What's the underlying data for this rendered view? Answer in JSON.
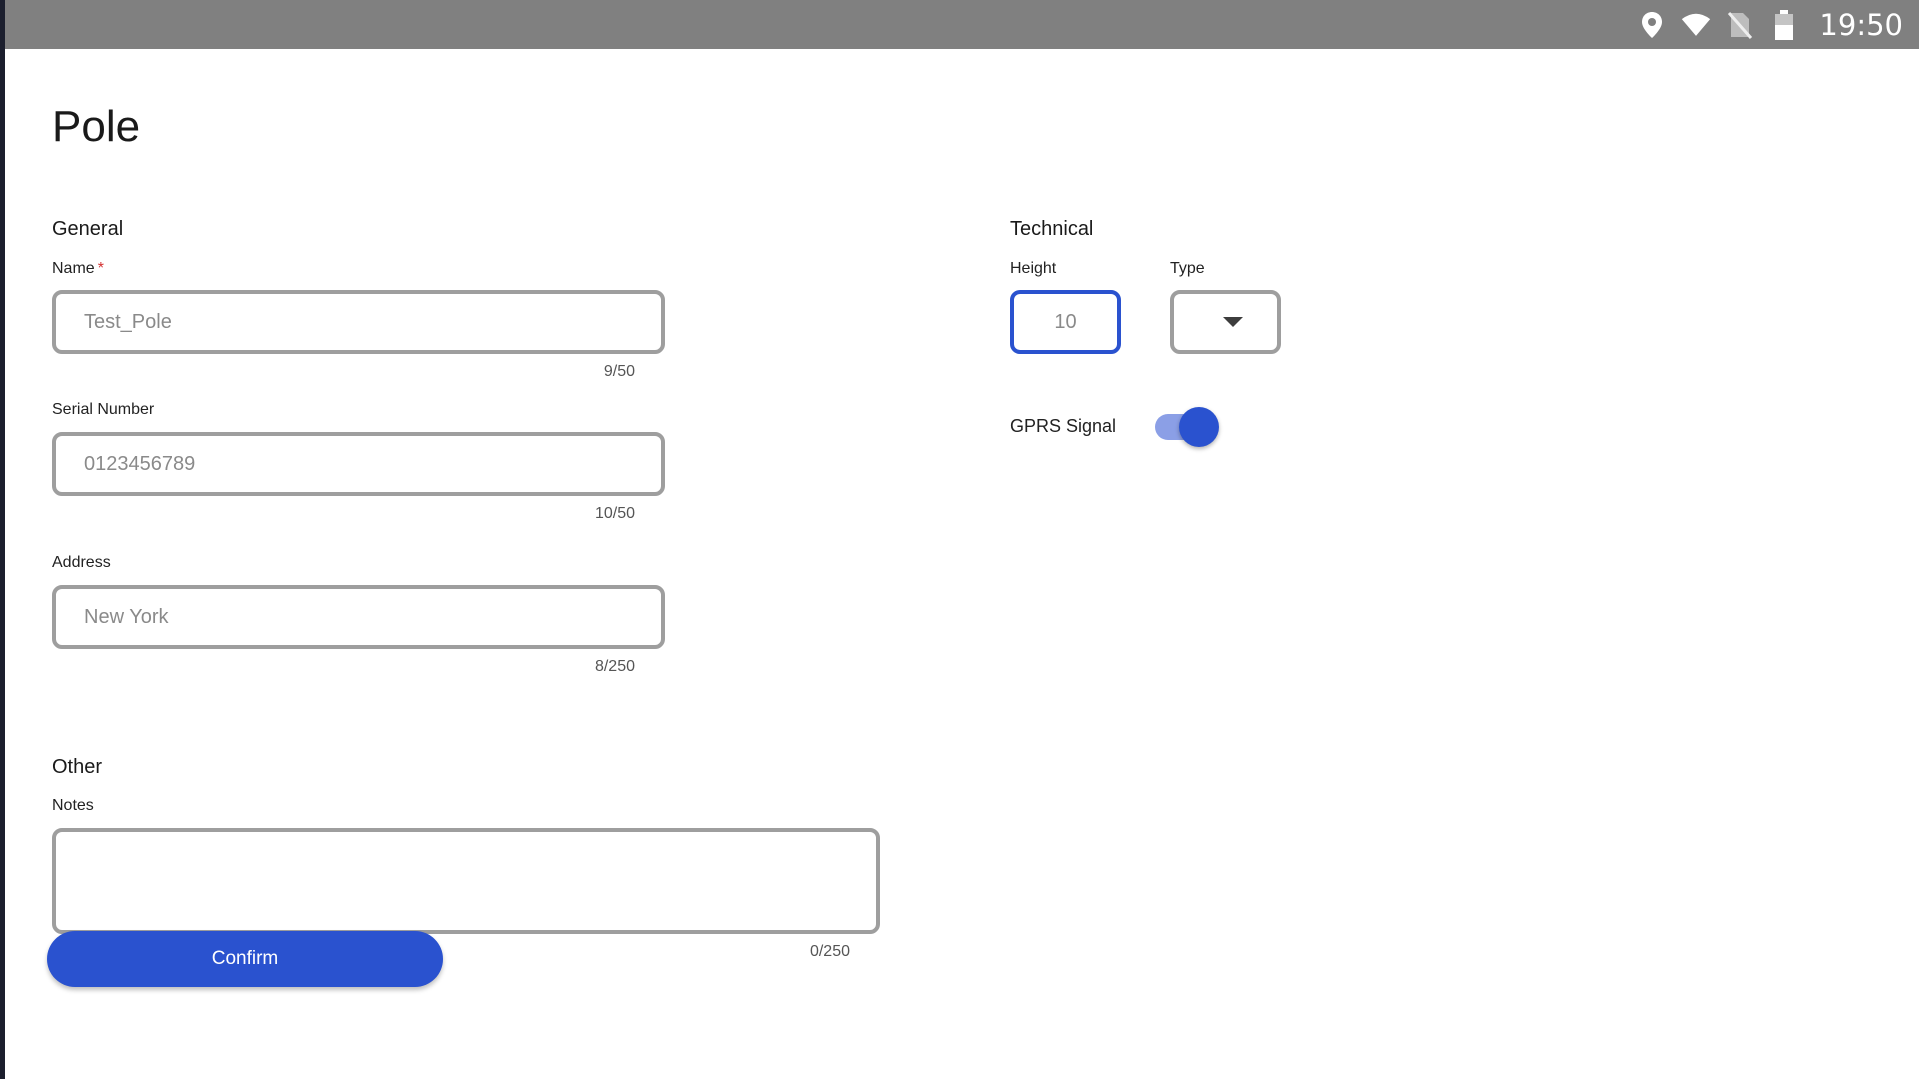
{
  "status_bar": {
    "time": "19:50",
    "icons": [
      "location-icon",
      "wifi-icon",
      "no-sim-icon",
      "battery-icon"
    ]
  },
  "page": {
    "title": "Pole"
  },
  "general": {
    "heading": "General",
    "name": {
      "label": "Name",
      "required_mark": "*",
      "value": "Test_Pole",
      "counter": "9/50"
    },
    "serial_number": {
      "label": "Serial Number",
      "value": "0123456789",
      "counter": "10/50"
    },
    "address": {
      "label": "Address",
      "value": "New York",
      "counter": "8/250"
    }
  },
  "technical": {
    "heading": "Technical",
    "height": {
      "label": "Height",
      "value": "10"
    },
    "type": {
      "label": "Type",
      "value": ""
    },
    "gprs_signal": {
      "label": "GPRS Signal",
      "enabled": true
    }
  },
  "other": {
    "heading": "Other",
    "notes": {
      "label": "Notes",
      "value": "",
      "counter": "0/250"
    }
  },
  "actions": {
    "confirm_label": "Confirm"
  },
  "colors": {
    "accent": "#2a52cf",
    "switch_track": "#8b9fe6",
    "status_bar": "#808080",
    "border": "#9e9e9e"
  }
}
